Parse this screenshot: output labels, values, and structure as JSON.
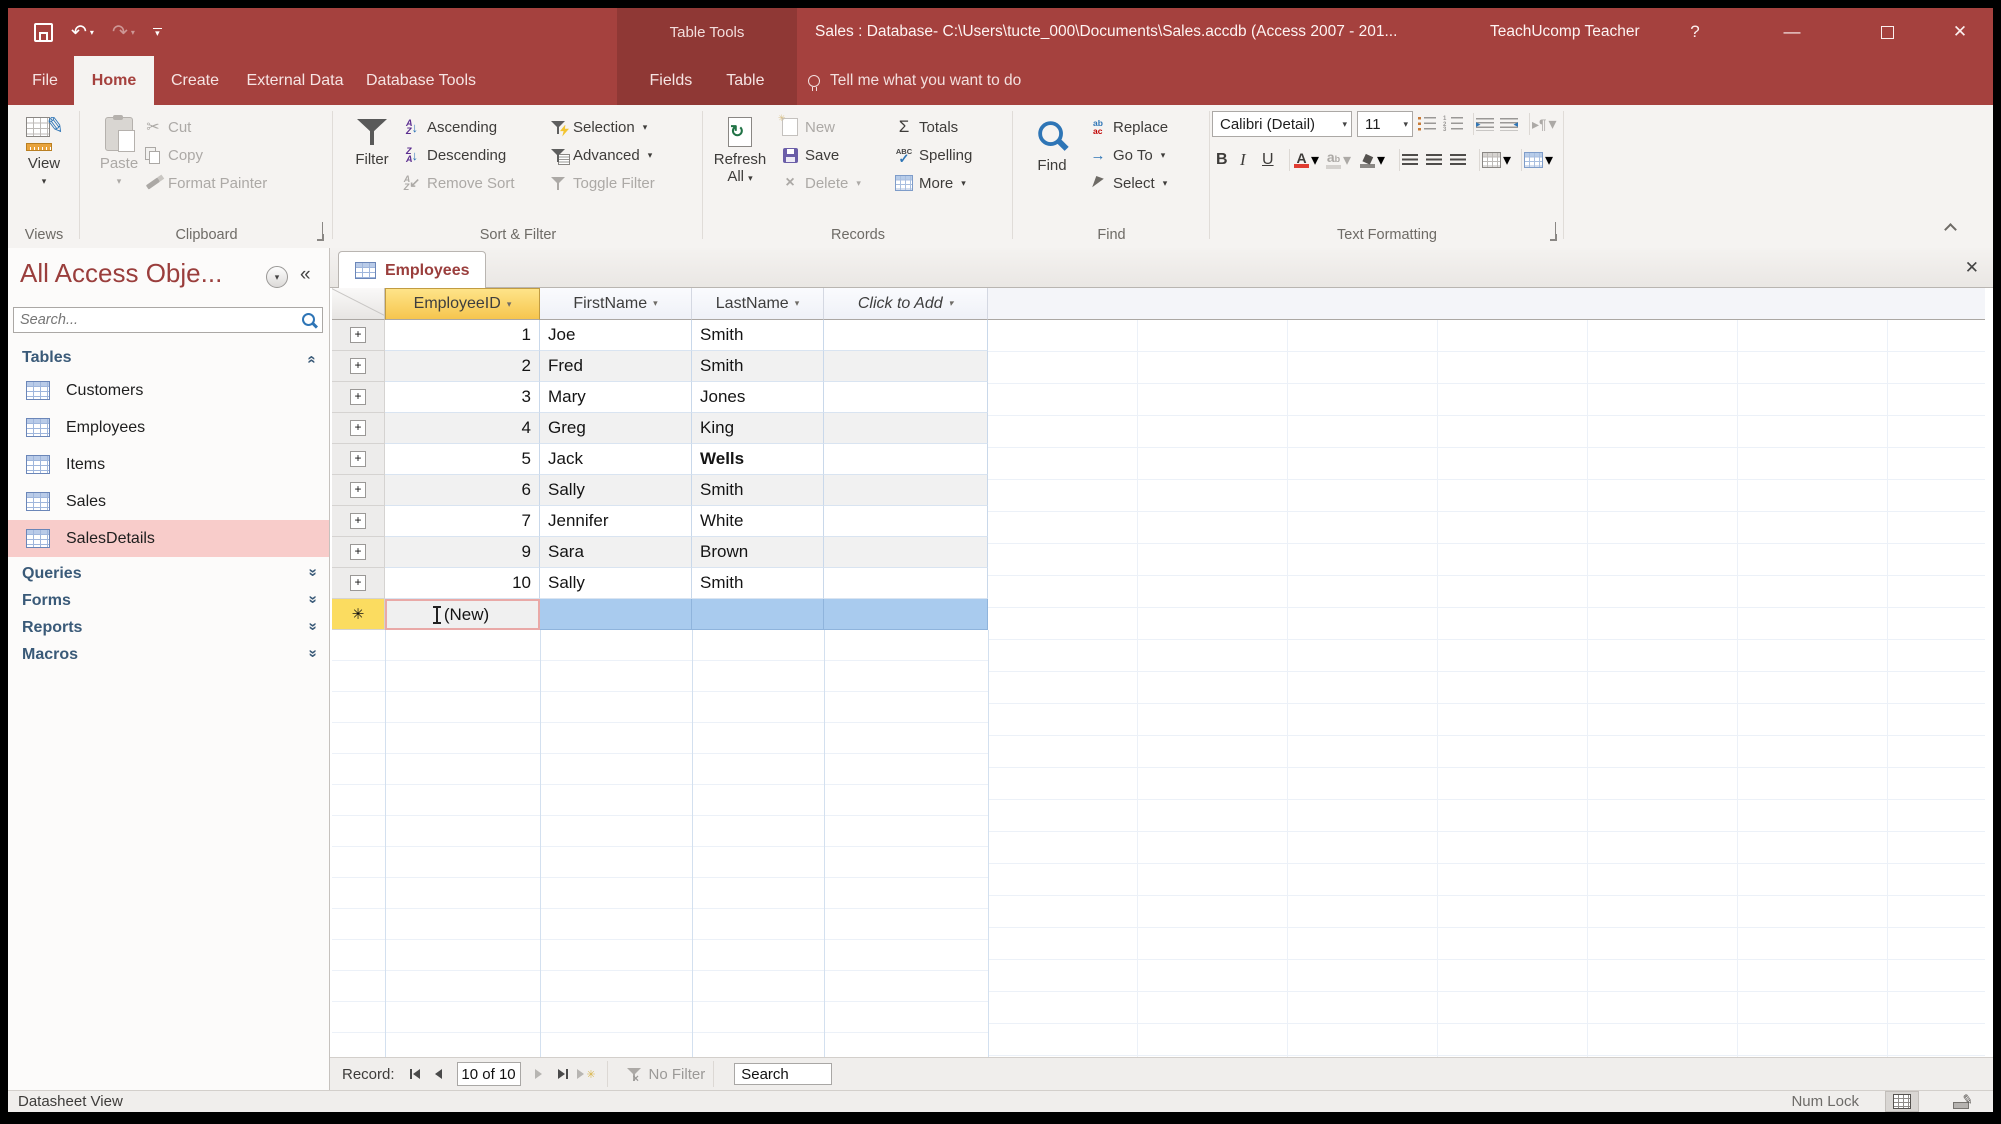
{
  "window": {
    "contextual_title": "Table Tools",
    "title": "Sales : Database- C:\\Users\\tucte_000\\Documents\\Sales.accdb (Access 2007 - 201...",
    "account": "TeachUcomp Teacher",
    "help": "?"
  },
  "tabs": {
    "file": "File",
    "home": "Home",
    "create": "Create",
    "external_data": "External Data",
    "database_tools": "Database Tools",
    "fields": "Fields",
    "table": "Table",
    "tell_me": "Tell me what you want to do"
  },
  "ribbon": {
    "views": {
      "label": "Views",
      "view": "View"
    },
    "clipboard": {
      "label": "Clipboard",
      "paste": "Paste",
      "cut": "Cut",
      "copy": "Copy",
      "format_painter": "Format Painter"
    },
    "sort_filter": {
      "label": "Sort & Filter",
      "filter": "Filter",
      "ascending": "Ascending",
      "descending": "Descending",
      "remove_sort": "Remove Sort",
      "selection": "Selection",
      "advanced": "Advanced",
      "toggle_filter": "Toggle Filter"
    },
    "records": {
      "label": "Records",
      "refresh_line1": "Refresh",
      "refresh_line2": "All",
      "new": "New",
      "save": "Save",
      "delete": "Delete",
      "totals": "Totals",
      "spelling": "Spelling",
      "more": "More"
    },
    "find_group": {
      "label": "Find",
      "find": "Find",
      "replace": "Replace",
      "goto": "Go To",
      "select": "Select"
    },
    "text_formatting": {
      "label": "Text Formatting",
      "font_name": "Calibri (Detail)",
      "font_size": "11",
      "bold": "B",
      "italic": "I",
      "underline": "U"
    }
  },
  "nav": {
    "title": "All Access Obje...",
    "search_placeholder": "Search...",
    "tables_section": "Tables",
    "tables": [
      {
        "label": "Customers"
      },
      {
        "label": "Employees"
      },
      {
        "label": "Items"
      },
      {
        "label": "Sales"
      },
      {
        "label": "SalesDetails",
        "selected": true
      }
    ],
    "collapsed_sections": [
      {
        "label": "Queries"
      },
      {
        "label": "Forms"
      },
      {
        "label": "Reports"
      },
      {
        "label": "Macros"
      }
    ]
  },
  "document": {
    "tab": "Employees",
    "columns": {
      "id": "EmployeeID",
      "first": "FirstName",
      "last": "LastName",
      "add": "Click to Add"
    },
    "rows": [
      {
        "id": "1",
        "first": "Joe",
        "last": "Smith"
      },
      {
        "id": "2",
        "first": "Fred",
        "last": "Smith"
      },
      {
        "id": "3",
        "first": "Mary",
        "last": "Jones"
      },
      {
        "id": "4",
        "first": "Greg",
        "last": "King"
      },
      {
        "id": "5",
        "first": "Jack",
        "last": "Wells",
        "emphasis": true
      },
      {
        "id": "6",
        "first": "Sally",
        "last": "Smith"
      },
      {
        "id": "7",
        "first": "Jennifer",
        "last": "White"
      },
      {
        "id": "9",
        "first": "Sara",
        "last": "Brown"
      },
      {
        "id": "10",
        "first": "Sally",
        "last": "Smith"
      }
    ],
    "new_row_label": "(New)"
  },
  "record_nav": {
    "record_label": "Record:",
    "position": "10 of 10",
    "no_filter": "No Filter",
    "search_placeholder": "Search"
  },
  "status": {
    "left": "Datasheet View",
    "num_lock": "Num Lock"
  },
  "icons": {
    "undo": "↶",
    "redo": "↷",
    "refresh": "↻",
    "totals": "Σ",
    "cut": "✂",
    "delete": "×",
    "goto": "→",
    "check": "✓",
    "asterisk": "✳",
    "close": "✕",
    "minimize": "—",
    "nav_collapse": "«",
    "expand_plus": "+",
    "dropdown": "▾",
    "tab_close": "✕"
  },
  "colors": {
    "accent_red": "#A5413E",
    "contextual_red": "#8F3835",
    "header_selected": "#F6C54E",
    "selection_blue": "#A9CBEE",
    "nav_selected": "#F8CCCA"
  }
}
